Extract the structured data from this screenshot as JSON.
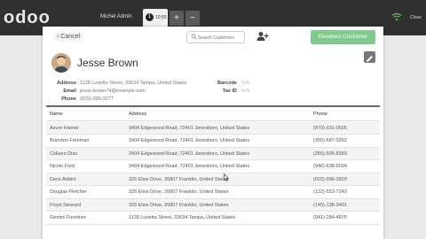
{
  "topbar": {
    "logo": "odoo",
    "user": "Michel Admin",
    "order_number": "1",
    "order_time": "10:55",
    "add_label": "+",
    "remove_label": "−",
    "close_label": "Close"
  },
  "toolbar": {
    "cancel_label": "Cancel",
    "search_placeholder": "Search Customers",
    "deselect_label": "Deselect Customer"
  },
  "customer": {
    "name": "Jesse Brown",
    "labels": {
      "address": "Address",
      "email": "Email",
      "phone": "Phone",
      "barcode": "Barcode",
      "tax_id": "Tax ID"
    },
    "address": "1128 Lunetta Street, 33634 Tampa, United States",
    "email": "jesse.brown74@example.com",
    "phone": "(829)-386-3277",
    "barcode": "N/A",
    "tax_id": "N/A"
  },
  "table": {
    "headers": [
      "Name",
      "Address",
      "Phone"
    ],
    "rows": [
      [
        "Azure Interior",
        "3404 Edgewood Road, 72401 Jonesboro, United States",
        "(870)-931-0505"
      ],
      [
        "Brandon Freeman",
        "3404 Edgewood Road, 72401 Jonesboro, United States",
        "(355)-687-3262"
      ],
      [
        "Colleen Diaz",
        "3404 Edgewood Road, 72401 Jonesboro, United States",
        "(255)-595-8393"
      ],
      [
        "Nicole Ford",
        "3404 Edgewood Road, 72401 Jonesboro, United States",
        "(946)-638-6034"
      ],
      [
        "Deco Addict",
        "325 Elsie Drive, 26807 Franklin, United States",
        "(603)-996-3829"
      ],
      [
        "Douglas Fletcher",
        "325 Elsie Drive, 26807 Franklin, United States",
        "(132)-553-7242"
      ],
      [
        "Floyd Steward",
        "325 Elsie Drive, 26807 Franklin, United States",
        "(145)-138-3401"
      ],
      [
        "Gemini Furniture",
        "1128 Lunetta Street, 33634 Tampa, United States",
        "(941)-284-4875"
      ]
    ]
  },
  "colors": {
    "topbar": "#303030",
    "accent_green": "#7fca8d",
    "wifi": "#5cb85c"
  }
}
